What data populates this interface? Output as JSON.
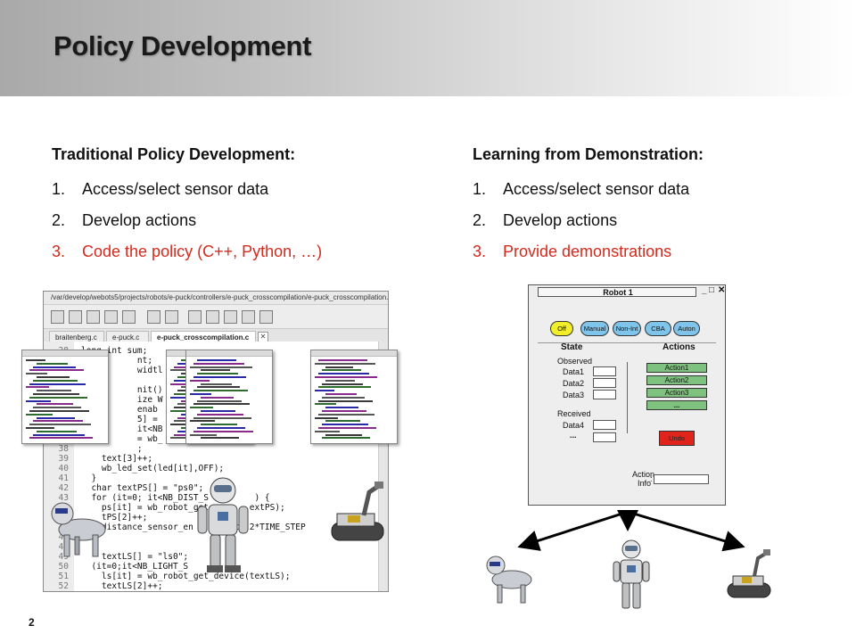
{
  "slide": {
    "title": "Policy Development",
    "page_number": "2"
  },
  "left_column": {
    "heading": "Traditional Policy Development:",
    "items": [
      {
        "num": "1.",
        "text": "Access/select sensor data"
      },
      {
        "num": "2.",
        "text": "Develop actions"
      },
      {
        "num": "3.",
        "text": "Code the policy (C++, Python, …)"
      }
    ]
  },
  "right_column": {
    "heading": "Learning from Demonstration:",
    "items": [
      {
        "num": "1.",
        "text": "Access/select sensor data"
      },
      {
        "num": "2.",
        "text": "Develop actions"
      },
      {
        "num": "3.",
        "text": "Provide demonstrations"
      }
    ]
  },
  "colors": {
    "highlight": "#d42a1e",
    "mode_off": "#f2ef2a",
    "mode_button": "#7fc4ea",
    "action_button": "#7fc27f",
    "undo_button": "#e0241c"
  },
  "editor": {
    "path": "/var/develop/webots5/projects/robots/e-puck/controllers/e-puck_crosscompilation/e-puck_crosscompilation.c",
    "tabs": [
      "braitenberg.c",
      "e-puck.c",
      "e-puck_crosscompilation.c"
    ],
    "code_lines": [
      {
        "ln": "28",
        "code": "long int sum;"
      },
      {
        "ln": "29",
        "code": "           nt;"
      },
      {
        "ln": "30",
        "code": "           widtl"
      },
      {
        "ln": "31",
        "code": ""
      },
      {
        "ln": "32",
        "code": "           nit()"
      },
      {
        "ln": "33",
        "code": "           ize W"
      },
      {
        "ln": "34",
        "code": "           enab"
      },
      {
        "ln": "35",
        "code": "           5] ="
      },
      {
        "ln": "36",
        "code": "           it<NB"
      },
      {
        "ln": "37",
        "code": "           = wb_"
      },
      {
        "ln": "38",
        "code": "           ;"
      },
      {
        "ln": "39",
        "code": "    text[3]++;"
      },
      {
        "ln": "40",
        "code": "    wb_led_set(led[it],OFF);"
      },
      {
        "ln": "41",
        "code": "  }"
      },
      {
        "ln": "42",
        "code": "  char textPS[] = \"ps0\";"
      },
      {
        "ln": "43",
        "code": "  for (it=0; it<NB_DIST_S         ) {"
      },
      {
        "ln": "44",
        "code": "    ps[it] = wb_robot_get        extPS);"
      },
      {
        "ln": "45",
        "code": "    tPS[2]++;"
      },
      {
        "ln": "46",
        "code": "    distance_sensor_en        t],2*TIME_STEP"
      },
      {
        "ln": "47",
        "code": ""
      },
      {
        "ln": "48",
        "code": ""
      },
      {
        "ln": "49",
        "code": "    textLS[] = \"ls0\";"
      },
      {
        "ln": "50",
        "code": "  (it=0;it<NB_LIGHT_S        {"
      },
      {
        "ln": "51",
        "code": "    ls[it] = wb_robot_get_device(textLS);"
      },
      {
        "ln": "52",
        "code": "    textLS[2]++;"
      }
    ]
  },
  "robot_gui": {
    "title": "Robot 1",
    "window_controls": [
      "_",
      "□",
      "✕"
    ],
    "modes": [
      "Off",
      "Manual",
      "Non-Int",
      "CBA",
      "Auton"
    ],
    "state_heading": "State",
    "actions_heading": "Actions",
    "observed_label": "Observed",
    "observed_fields": [
      "Data1",
      "Data2",
      "Data3"
    ],
    "received_label": "Received",
    "received_fields": [
      "Data4",
      "..."
    ],
    "action_buttons": [
      "Action1",
      "Action2",
      "Action3",
      "..."
    ],
    "undo_label": "Undo",
    "action_info_label_1": "Action",
    "action_info_label_2": "Info",
    "action_info_colon": ":"
  }
}
